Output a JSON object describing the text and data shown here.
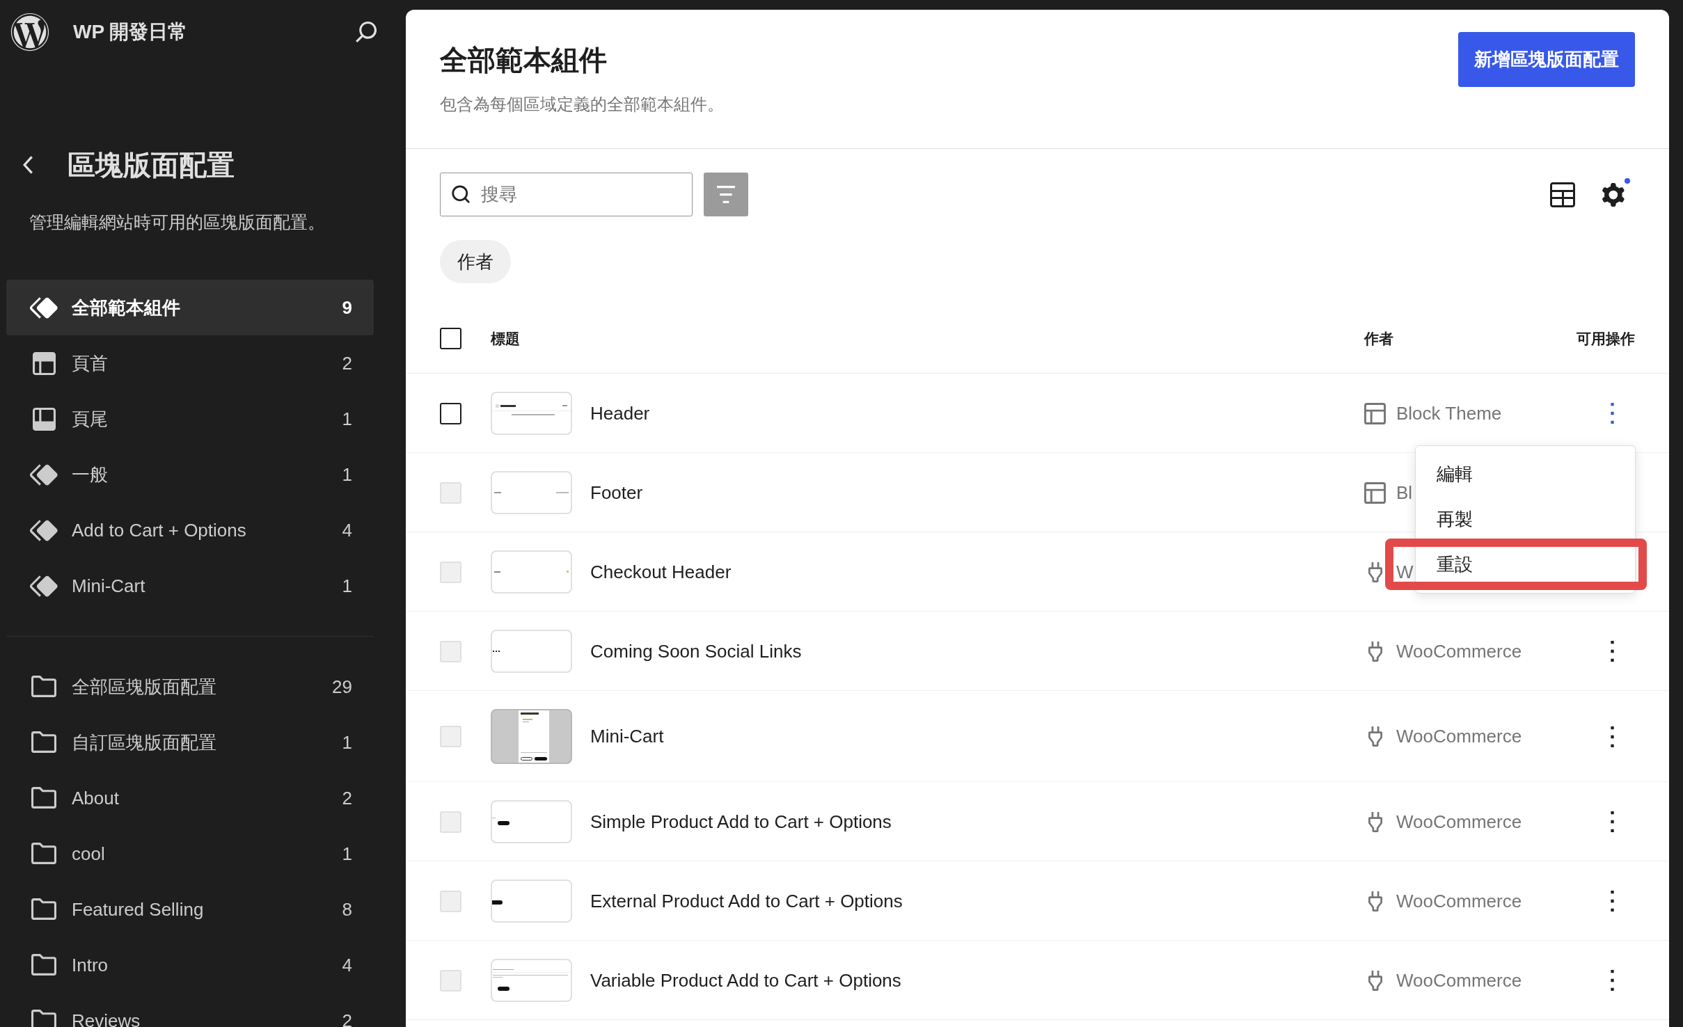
{
  "site": {
    "title": "WP 開發日常"
  },
  "sidebar": {
    "title": "區塊版面配置",
    "description": "管理編輯網站時可用的區塊版面配置。",
    "areas": [
      {
        "kind": "symbol",
        "label": "全部範本組件",
        "count": "9",
        "selected": true
      },
      {
        "kind": "header",
        "label": "頁首",
        "count": "2",
        "selected": false
      },
      {
        "kind": "footer",
        "label": "頁尾",
        "count": "1",
        "selected": false
      },
      {
        "kind": "symbol",
        "label": "一般",
        "count": "1",
        "selected": false
      },
      {
        "kind": "symbol",
        "label": "Add to Cart + Options",
        "count": "4",
        "selected": false
      },
      {
        "kind": "symbol",
        "label": "Mini-Cart",
        "count": "1",
        "selected": false
      }
    ],
    "categories": [
      {
        "label": "全部區塊版面配置",
        "count": "29",
        "selected": false
      },
      {
        "label": "自訂區塊版面配置",
        "count": "1",
        "selected": false
      },
      {
        "label": "About",
        "count": "2",
        "selected": false
      },
      {
        "label": "cool",
        "count": "1",
        "selected": false
      },
      {
        "label": "Featured Selling",
        "count": "8",
        "selected": false
      },
      {
        "label": "Intro",
        "count": "4",
        "selected": false
      },
      {
        "label": "Reviews",
        "count": "2",
        "selected": false
      }
    ]
  },
  "main": {
    "title": "全部範本組件",
    "description": "包含為每個區域定義的全部範本組件。",
    "add_button": "新增區塊版面配置",
    "search": {
      "placeholder": "搜尋"
    },
    "view_options_modified": true,
    "filters": [
      {
        "label": "作者"
      }
    ],
    "table": {
      "select_all_checked": false,
      "columns": [
        "標題",
        "作者",
        "可用操作"
      ],
      "rows": [
        {
          "title": "Header",
          "preview": {
            "kind": "header"
          },
          "author": {
            "kind": "theme",
            "name": "Block Theme"
          },
          "checked": false,
          "disabled": false,
          "menu_open": true
        },
        {
          "title": "Footer",
          "preview": {
            "kind": "footer"
          },
          "author": {
            "kind": "theme",
            "name": "Bl"
          },
          "checked": false,
          "disabled": true,
          "menu_open": false
        },
        {
          "title": "Checkout Header",
          "preview": {
            "kind": "checkout"
          },
          "author": {
            "kind": "plugin",
            "name": "W"
          },
          "checked": false,
          "disabled": true,
          "menu_open": false
        },
        {
          "title": "Coming Soon Social Links",
          "preview": {
            "kind": "social"
          },
          "author": {
            "kind": "plugin",
            "name": "WooCommerce"
          },
          "checked": false,
          "disabled": true,
          "menu_open": false
        },
        {
          "title": "Mini-Cart",
          "preview": {
            "kind": "minicart"
          },
          "author": {
            "kind": "plugin",
            "name": "WooCommerce"
          },
          "checked": false,
          "disabled": true,
          "menu_open": false
        },
        {
          "title": "Simple Product Add to Cart + Options",
          "preview": {
            "kind": "simple"
          },
          "author": {
            "kind": "plugin",
            "name": "WooCommerce"
          },
          "checked": false,
          "disabled": true,
          "menu_open": false
        },
        {
          "title": "External Product Add to Cart + Options",
          "preview": {
            "kind": "external"
          },
          "author": {
            "kind": "plugin",
            "name": "WooCommerce"
          },
          "checked": false,
          "disabled": true,
          "menu_open": false
        },
        {
          "title": "Variable Product Add to Cart + Options",
          "preview": {
            "kind": "variable"
          },
          "author": {
            "kind": "plugin",
            "name": "WooCommerce"
          },
          "checked": false,
          "disabled": true,
          "menu_open": false
        }
      ]
    },
    "row_menu": {
      "items": [
        {
          "label": "編輯",
          "highlighted": false
        },
        {
          "label": "再製",
          "highlighted": false
        },
        {
          "label": "重設",
          "highlighted": true
        }
      ]
    }
  }
}
